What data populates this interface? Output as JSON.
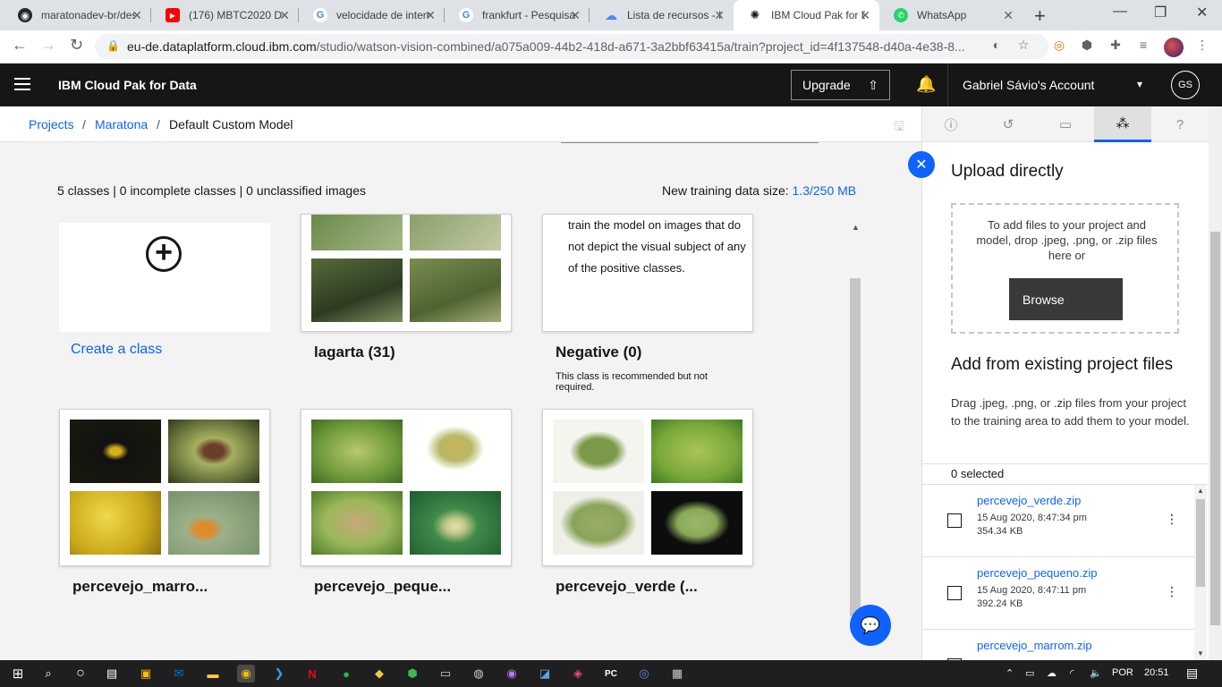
{
  "browser": {
    "tabs": [
      {
        "title": "maratonadev-br/desafio",
        "icon": "github-icon",
        "color": "#24292e"
      },
      {
        "title": "(176) MBTC2020 Desafio",
        "icon": "youtube-icon",
        "color": "#ff0000"
      },
      {
        "title": "velocidade de internet",
        "icon": "google-icon",
        "color": "#4285f4"
      },
      {
        "title": "frankfurt - Pesquisa",
        "icon": "google-icon",
        "color": "#4285f4"
      },
      {
        "title": "Lista de recursos - IBM",
        "icon": "cloud-icon",
        "color": "#4589ff"
      },
      {
        "title": "IBM Cloud Pak for Data",
        "icon": "ibm-icon",
        "color": "#161616"
      },
      {
        "title": "WhatsApp",
        "icon": "whatsapp-icon",
        "color": "#25d366"
      }
    ],
    "url_host": "eu-de.dataplatform.cloud.ibm.com",
    "url_path": "/studio/watson-vision-combined/a075a009-44b2-418d-a671-3a2bbf63415a/train?project_id=4f137548-d40a-4e38-8..."
  },
  "header": {
    "brand": "IBM Cloud Pak for Data",
    "upgrade_label": "Upgrade",
    "account_label": "Gabriel Sávio's Account",
    "initials": "GS"
  },
  "breadcrumb": {
    "projects": "Projects",
    "maratona": "Maratona",
    "current": "Default Custom Model",
    "sep": "/"
  },
  "main": {
    "summary": "5 classes | 0 incomplete classes | 0 unclassified images",
    "data_size_label": "New training data size:",
    "data_size_value": "1.3/250 MB",
    "create_class": "Create a class",
    "negative_text": "train the model on images that do not depict the visual subject of any of the positive classes.",
    "negative_note": "This class is recommended but not required.",
    "classes": [
      {
        "label": "lagarta (31)"
      },
      {
        "label": "Negative (0)"
      },
      {
        "label": "percevejo_marro..."
      },
      {
        "label": "percevejo_peque..."
      },
      {
        "label": "percevejo_verde (..."
      }
    ]
  },
  "panel": {
    "upload_title": "Upload directly",
    "drop_text": "To add files to your project and model, drop .jpeg, .png, or .zip files here or",
    "browse_label": "Browse",
    "existing_title": "Add from existing project files",
    "existing_desc": "Drag .jpeg, .png, or .zip files from your project to the training area to add them to your model.",
    "selected": "0 selected",
    "files": [
      {
        "name": "percevejo_verde.zip",
        "date": "15 Aug 2020, 8:47:34 pm",
        "size": "354.34 KB"
      },
      {
        "name": "percevejo_pequeno.zip",
        "date": "15 Aug 2020, 8:47:11 pm",
        "size": "392.24 KB"
      },
      {
        "name": "percevejo_marrom.zip",
        "date": "",
        "size": ""
      }
    ]
  },
  "taskbar": {
    "lang": "POR",
    "time": "20:51"
  },
  "colors": {
    "ibm_blue": "#0f62fe",
    "header_bg": "#161616",
    "canvas_bg": "#f3f3f3"
  }
}
